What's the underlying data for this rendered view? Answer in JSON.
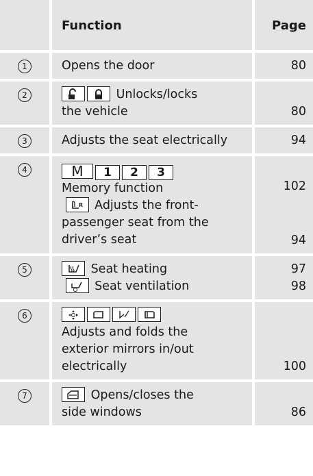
{
  "header": {
    "function_label": "Function",
    "page_label": "Page"
  },
  "rows": [
    {
      "num": "1",
      "text_lines": [
        "Opens the door"
      ],
      "page": "80"
    },
    {
      "num": "2",
      "inline_text": "Unlocks/locks",
      "text_lines": [
        "the vehicle"
      ],
      "page": "80",
      "icons": [
        "unlock-key-icon",
        "lock-key-icon"
      ]
    },
    {
      "num": "3",
      "text_lines": [
        "Adjusts the seat electrically"
      ],
      "page": "94"
    },
    {
      "num": "4",
      "memory_keys": [
        "M",
        "1",
        "2",
        "3"
      ],
      "memory_text": "Memory function",
      "memory_page": "102",
      "passenger_inline": "Adjusts the front-",
      "passenger_lines": [
        "passenger seat from the",
        "driver’s seat"
      ],
      "passenger_page": "94",
      "icons": [
        "passenger-seat-key-icon"
      ]
    },
    {
      "num": "5",
      "heating_text": "Seat heating",
      "heating_page": "97",
      "ventilation_text": "Seat ventilation",
      "ventilation_page": "98",
      "icons": [
        "seat-heating-key-icon",
        "seat-ventilation-key-icon"
      ]
    },
    {
      "num": "6",
      "text_lines": [
        "Adjusts and folds the",
        "exterior mirrors in/out",
        "electrically"
      ],
      "page": "100",
      "icons": [
        "mirror-adjust-key-icon",
        "mirror-right-key-icon",
        "mirror-fold-key-icon",
        "mirror-left-key-icon"
      ]
    },
    {
      "num": "7",
      "inline_text": "Opens/closes the",
      "text_lines": [
        "side windows"
      ],
      "page": "86",
      "icons": [
        "side-window-key-icon"
      ]
    }
  ]
}
